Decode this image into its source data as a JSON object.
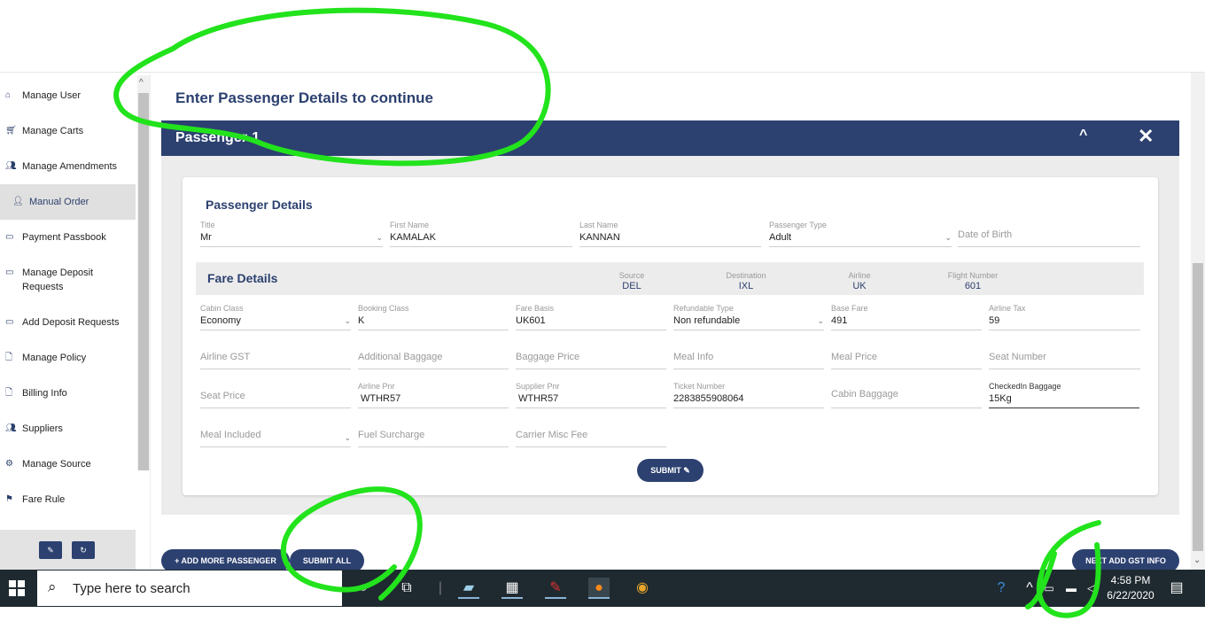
{
  "sidebar": {
    "items": [
      {
        "label": "Manage User",
        "icon": "home-icon"
      },
      {
        "label": "Manage Carts",
        "icon": "cart-icon"
      },
      {
        "label": "Manage Amendments",
        "icon": "users-icon"
      },
      {
        "label": "Manual Order",
        "icon": "user-plus-icon"
      },
      {
        "label": "Payment Passbook",
        "icon": "money-icon"
      },
      {
        "label": "Manage Deposit Requests",
        "icon": "money-icon"
      },
      {
        "label": "Add Deposit Requests",
        "icon": "money-icon"
      },
      {
        "label": "Manage Policy",
        "icon": "file-icon"
      },
      {
        "label": "Billing Info",
        "icon": "file-icon"
      },
      {
        "label": "Suppliers",
        "icon": "users-icon"
      },
      {
        "label": "Manage Source",
        "icon": "cubes-icon"
      },
      {
        "label": "Fare Rule",
        "icon": "flag-icon"
      }
    ],
    "footer_edit_icon": "✎",
    "footer_refresh_icon": "↻"
  },
  "main": {
    "title": "Enter Passenger Details to continue",
    "panel_title": "Passenger-1",
    "collapse_glyph": "^",
    "close_glyph": "✕"
  },
  "passenger": {
    "section_title": "Passenger Details",
    "title_label": "Title",
    "title_value": "Mr",
    "first_name_label": "First Name",
    "first_name_value": "KAMALAK",
    "last_name_label": "Last Name",
    "last_name_value": "KANNAN",
    "pax_type_label": "Passenger Type",
    "pax_type_value": "Adult",
    "dob_placeholder": "Date of Birth"
  },
  "fare": {
    "section_title": "Fare Details",
    "source_label": "Source",
    "source_value": "DEL",
    "destination_label": "Destination",
    "destination_value": "IXL",
    "airline_label": "Airline",
    "airline_value": "UK",
    "flight_label": "Flight Number",
    "flight_value": "601",
    "cabin_class_label": "Cabin Class",
    "cabin_class_value": "Economy",
    "booking_class_label": "Booking Class",
    "booking_class_value": "K",
    "fare_basis_label": "Fare Basis",
    "fare_basis_value": "UK601",
    "refundable_label": "Refundable Type",
    "refundable_value": "Non refundable",
    "base_fare_label": "Base Fare",
    "base_fare_value": "491",
    "airline_tax_label": "Airline Tax",
    "airline_tax_value": "59",
    "airline_gst_ph": "Airline GST",
    "add_baggage_ph": "Additional Baggage",
    "baggage_price_ph": "Baggage Price",
    "meal_info_ph": "Meal Info",
    "meal_price_ph": "Meal Price",
    "seat_number_ph": "Seat Number",
    "seat_price_ph": "Seat Price",
    "airline_pnr_label": "Airline Pnr",
    "airline_pnr_value": "WTHR57",
    "supplier_pnr_label": "Supplier Pnr",
    "supplier_pnr_value": "WTHR57",
    "ticket_label": "Ticket Number",
    "ticket_value": "2283855908064",
    "cabin_baggage_ph": "Cabin Baggage",
    "checked_label": "CheckedIn Baggage",
    "checked_value": "15Kg",
    "meal_included_ph": "Meal Included",
    "fuel_ph": "Fuel Surcharge",
    "carrier_ph": "Carrier Misc Fee",
    "submit_label": "SUBMIT ✎"
  },
  "actions": {
    "add_more": "+ ADD MORE PASSENGER",
    "submit_all": "SUBMIT ALL",
    "next_gst": "NEXT ADD GST INFO"
  },
  "taskbar": {
    "search_placeholder": "Type here to search",
    "time": "4:58 PM",
    "date": "6/22/2020"
  },
  "colors": {
    "primary": "#2c4170",
    "annotation": "#22e31c"
  }
}
